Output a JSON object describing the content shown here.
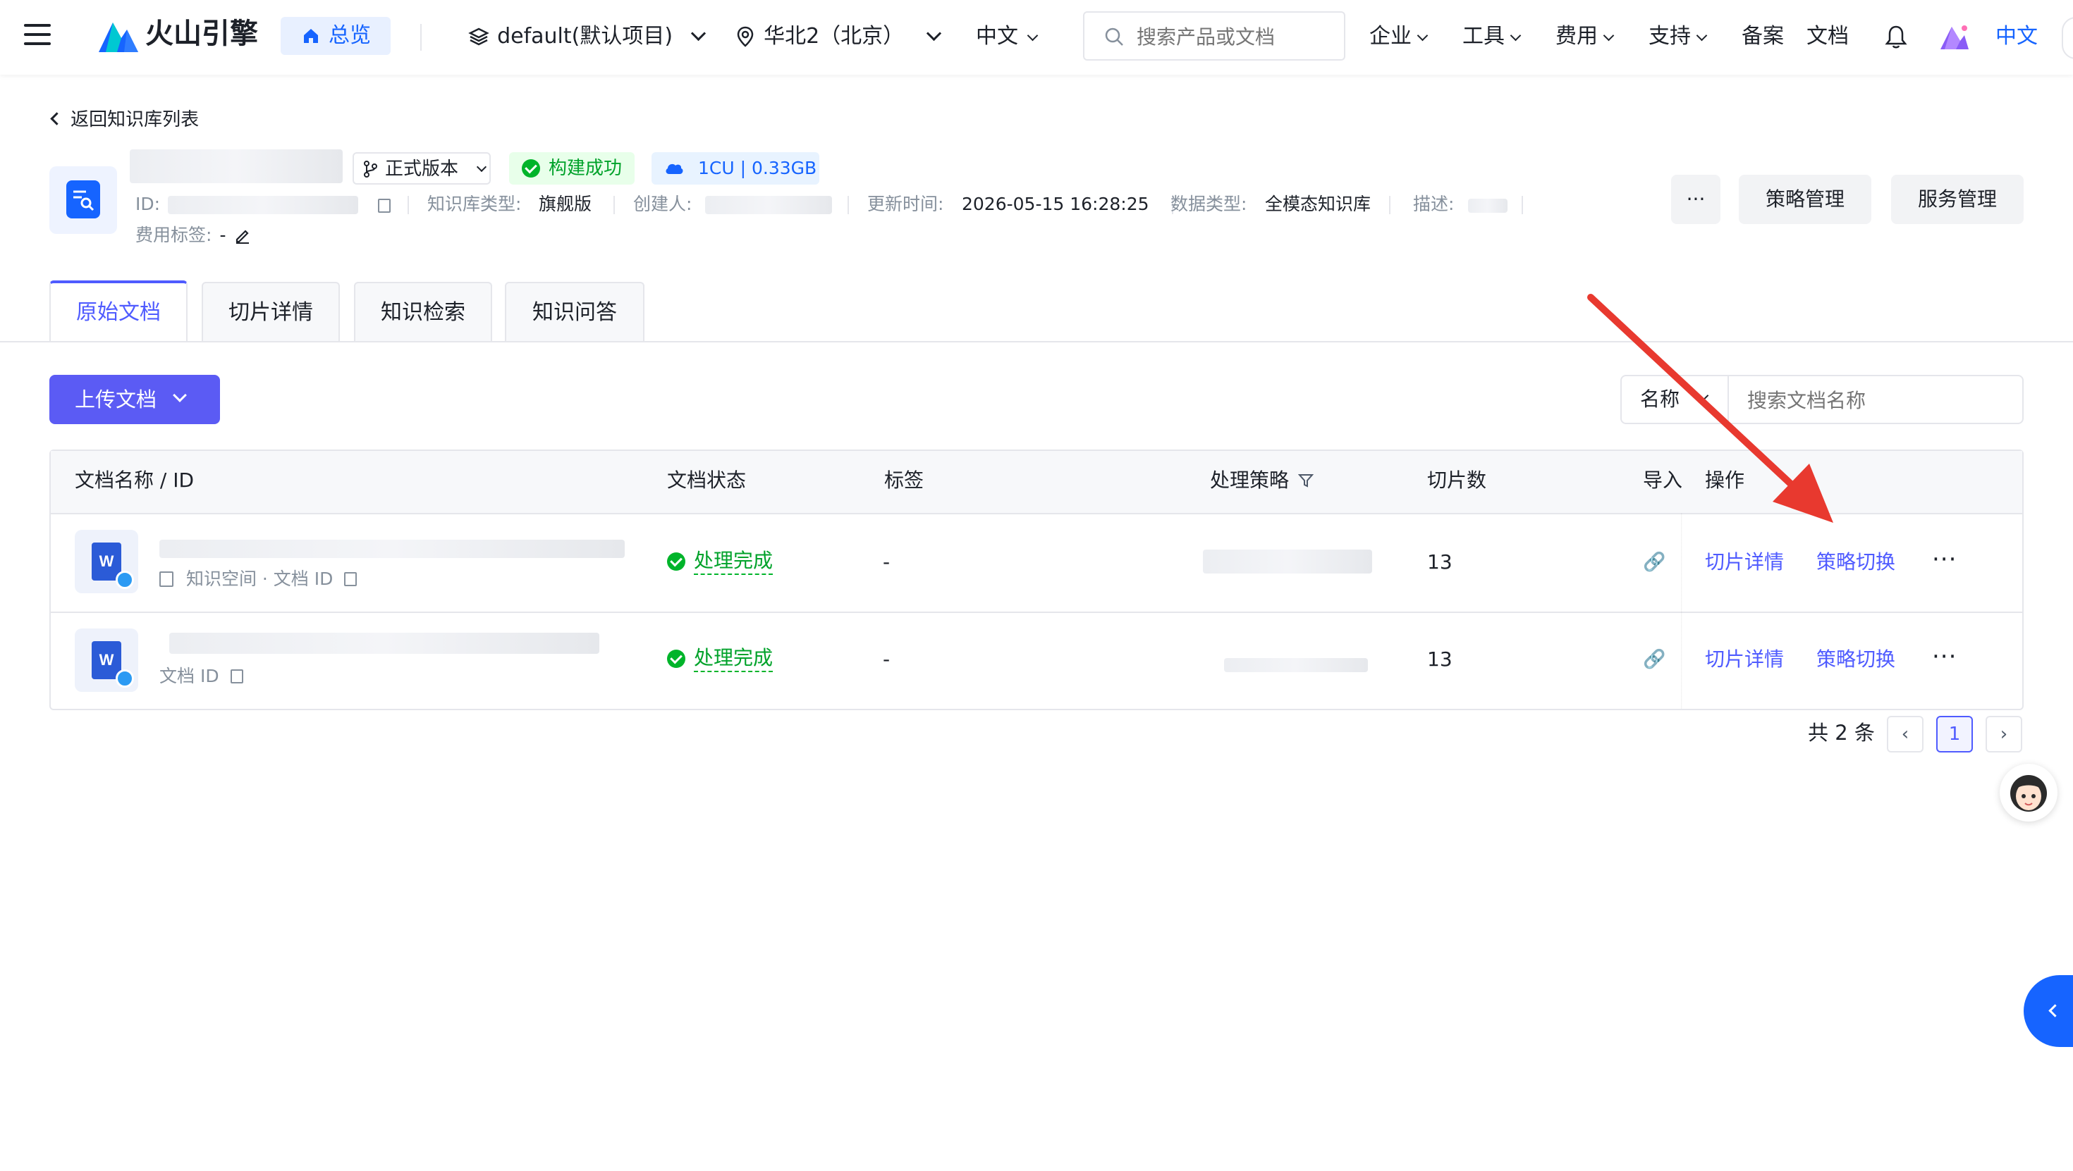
{
  "topnav": {
    "logo_text": "火山引擎",
    "overview_label": "总览",
    "project_label": "default(默认项目)",
    "region_label": "华北2（北京）",
    "language_label": "中文",
    "search_placeholder": "搜索产品或文档",
    "menu": [
      "企业",
      "工具",
      "费用",
      "支持"
    ],
    "links": [
      "备案",
      "文档"
    ],
    "lang_right": "中文"
  },
  "header": {
    "back_link": "返回知识库列表",
    "version_label": "正式版本",
    "build_status": "构建成功",
    "resource": "1CU | 0.33GB",
    "id_label": "ID:",
    "kb_type_label": "知识库类型:",
    "kb_type_value": "旗舰版",
    "creator_label": "创建人:",
    "updated_label": "更新时间:",
    "updated_value": "2026-05-15 16:28:25",
    "data_type_label": "数据类型:",
    "data_type_value": "全模态知识库",
    "desc_label": "描述:",
    "cost_tag_label": "费用标签:",
    "cost_tag_value": "-",
    "more_label": "···",
    "strategy_btn": "策略管理",
    "service_btn": "服务管理"
  },
  "tabs": [
    "原始文档",
    "切片详情",
    "知识检索",
    "知识问答"
  ],
  "toolbar": {
    "upload_label": "上传文档",
    "filter_label": "名称",
    "search_placeholder": "搜索文档名称"
  },
  "table": {
    "headers": [
      "文档名称 / ID",
      "文档状态",
      "标签",
      "处理策略",
      "切片数",
      "导入",
      "操作"
    ],
    "rows": [
      {
        "meta": "知识空间 · 文档 ID",
        "status": "处理完成",
        "tag": "-",
        "slices": "13",
        "op1": "切片详情",
        "op2": "策略切换",
        "more": "···"
      },
      {
        "meta": "文档 ID",
        "status": "处理完成",
        "tag": "-",
        "slices": "13",
        "op1": "切片详情",
        "op2": "策略切换",
        "more": "···"
      }
    ]
  },
  "pagination": {
    "total_label": "共 2 条",
    "current_page": "1"
  },
  "colors": {
    "accent": "#4f5bff",
    "success": "#00b42a",
    "annotation_arrow": "#e8392f"
  }
}
